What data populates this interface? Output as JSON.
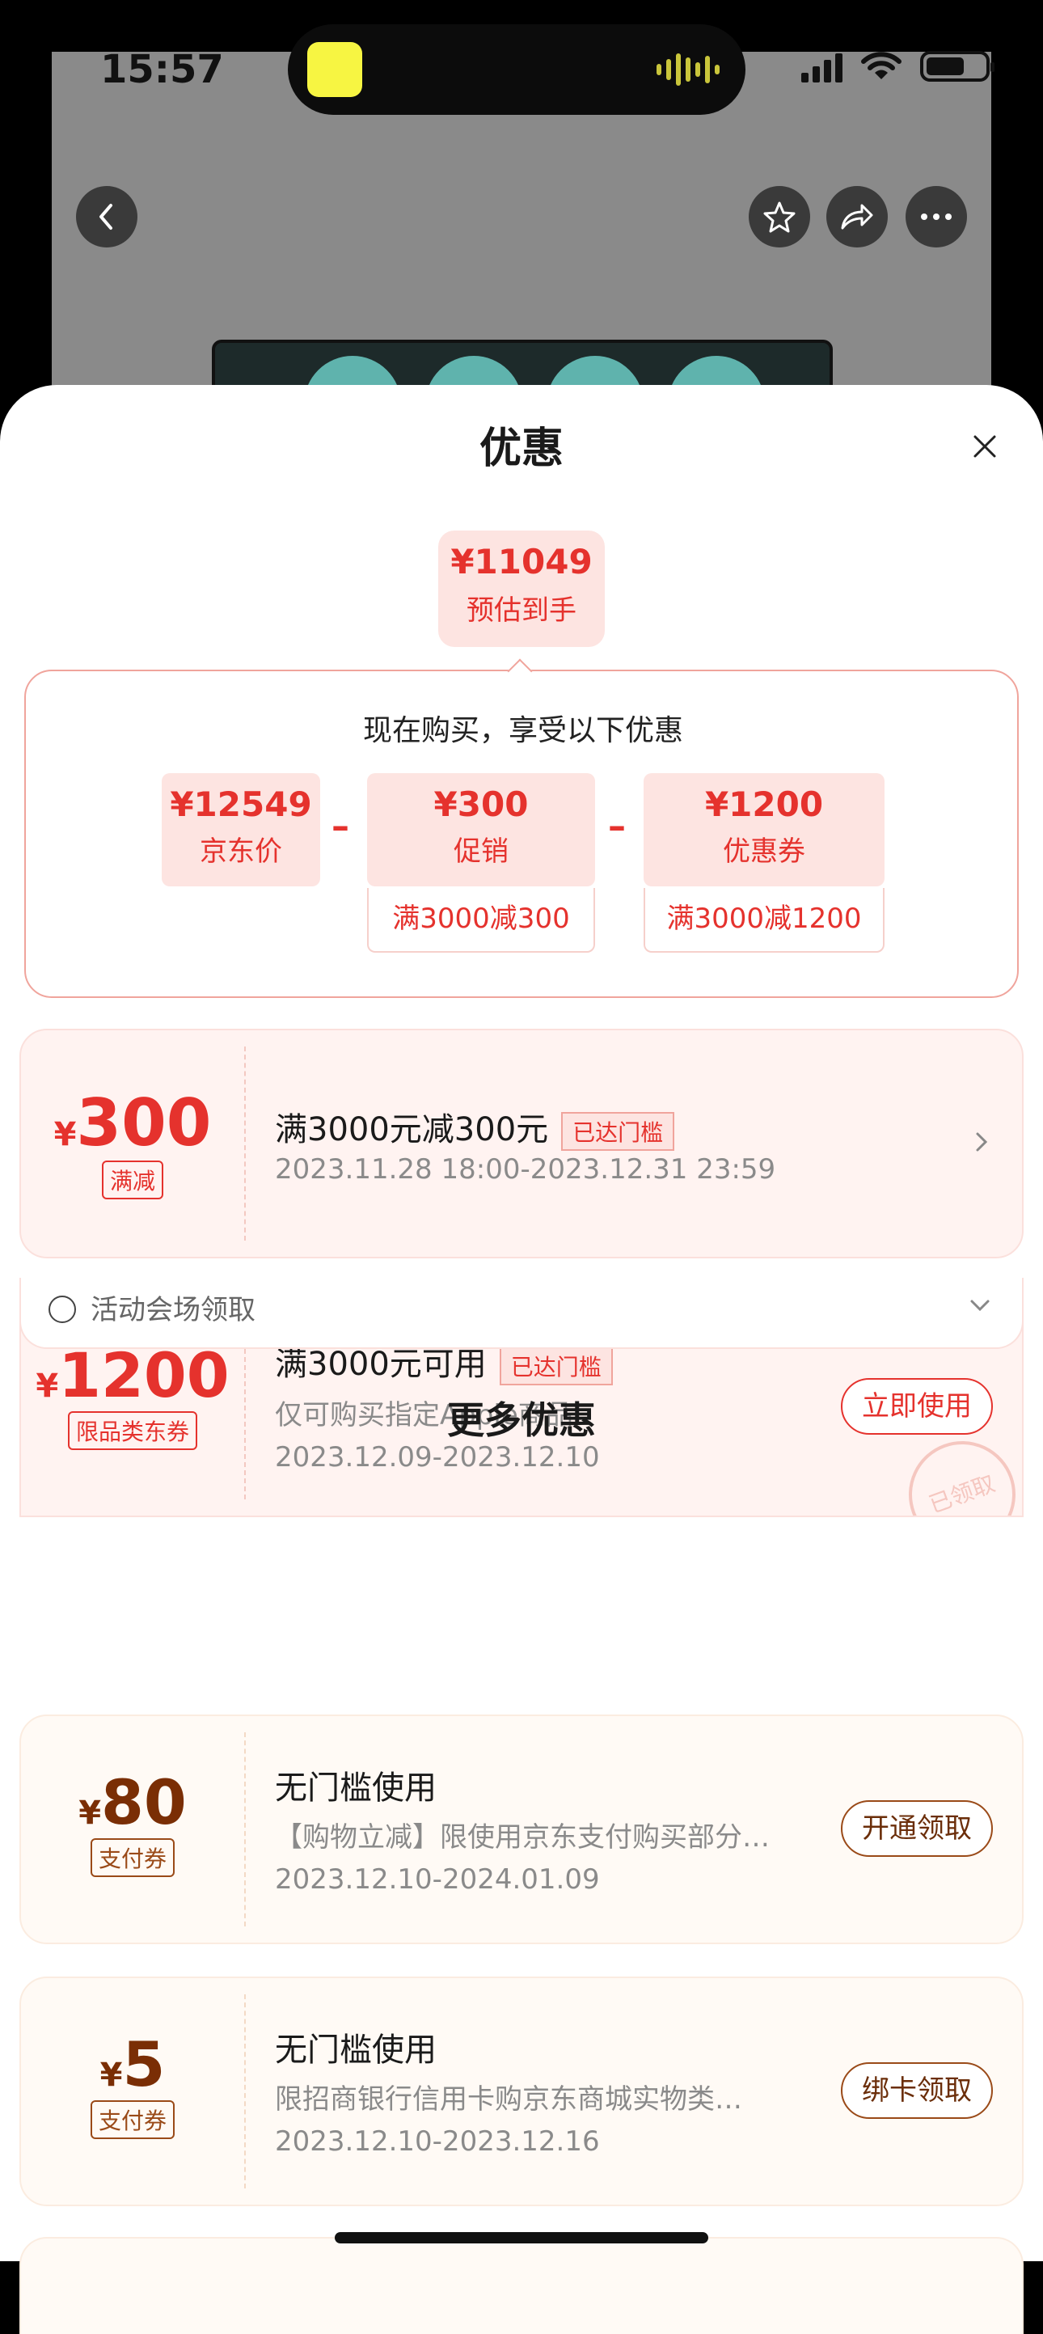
{
  "status_bar": {
    "time": "15:57"
  },
  "sheet": {
    "title": "优惠",
    "estimate": {
      "price": "¥11049",
      "label": "预估到手"
    },
    "calc": {
      "heading": "现在购买，享受以下优惠",
      "items": [
        {
          "price": "¥12549",
          "label": "京东价"
        },
        {
          "price": "¥300",
          "label": "促销",
          "rule": "满3000减300"
        },
        {
          "price": "¥1200",
          "label": "优惠券",
          "rule": "满3000减1200"
        }
      ],
      "operator": "–"
    },
    "coupons": [
      {
        "yen": "¥",
        "amount": "300",
        "tag": "满减",
        "title": "满3000元减300元",
        "badge": "已达门槛",
        "dates": "2023.11.28 18:00-2023.12.31 23:59"
      },
      {
        "yen": "¥",
        "amount": "1200",
        "tag": "限品类东券",
        "title": "满3000元可用",
        "badge": "已达门槛",
        "desc": "仅可购买指定Apple商品",
        "dates": "2023.12.09-2023.12.10",
        "button": "立即使用",
        "stamp": "已领取",
        "source": "活动会场领取"
      }
    ],
    "more_title": "更多优惠",
    "more_coupons": [
      {
        "yen": "¥",
        "amount": "80",
        "tag": "支付券",
        "title": "无门槛使用",
        "desc": "【购物立减】限使用京东支付购买部分…",
        "dates": "2023.12.10-2024.01.09",
        "button": "开通领取"
      },
      {
        "yen": "¥",
        "amount": "5",
        "tag": "支付券",
        "title": "无门槛使用",
        "desc": "限招商银行信用卡购京东商城实物类…",
        "dates": "2023.12.10-2023.12.16",
        "button": "绑卡领取"
      }
    ]
  },
  "colors": {
    "accent": "#e5322d",
    "brown": "#9a4a18",
    "pink_bg": "#fde4e1"
  },
  "icons": [
    "back-icon",
    "star-icon",
    "share-icon",
    "more-icon",
    "close-icon",
    "chevron-right-icon",
    "chevron-down-icon",
    "source-icon"
  ]
}
